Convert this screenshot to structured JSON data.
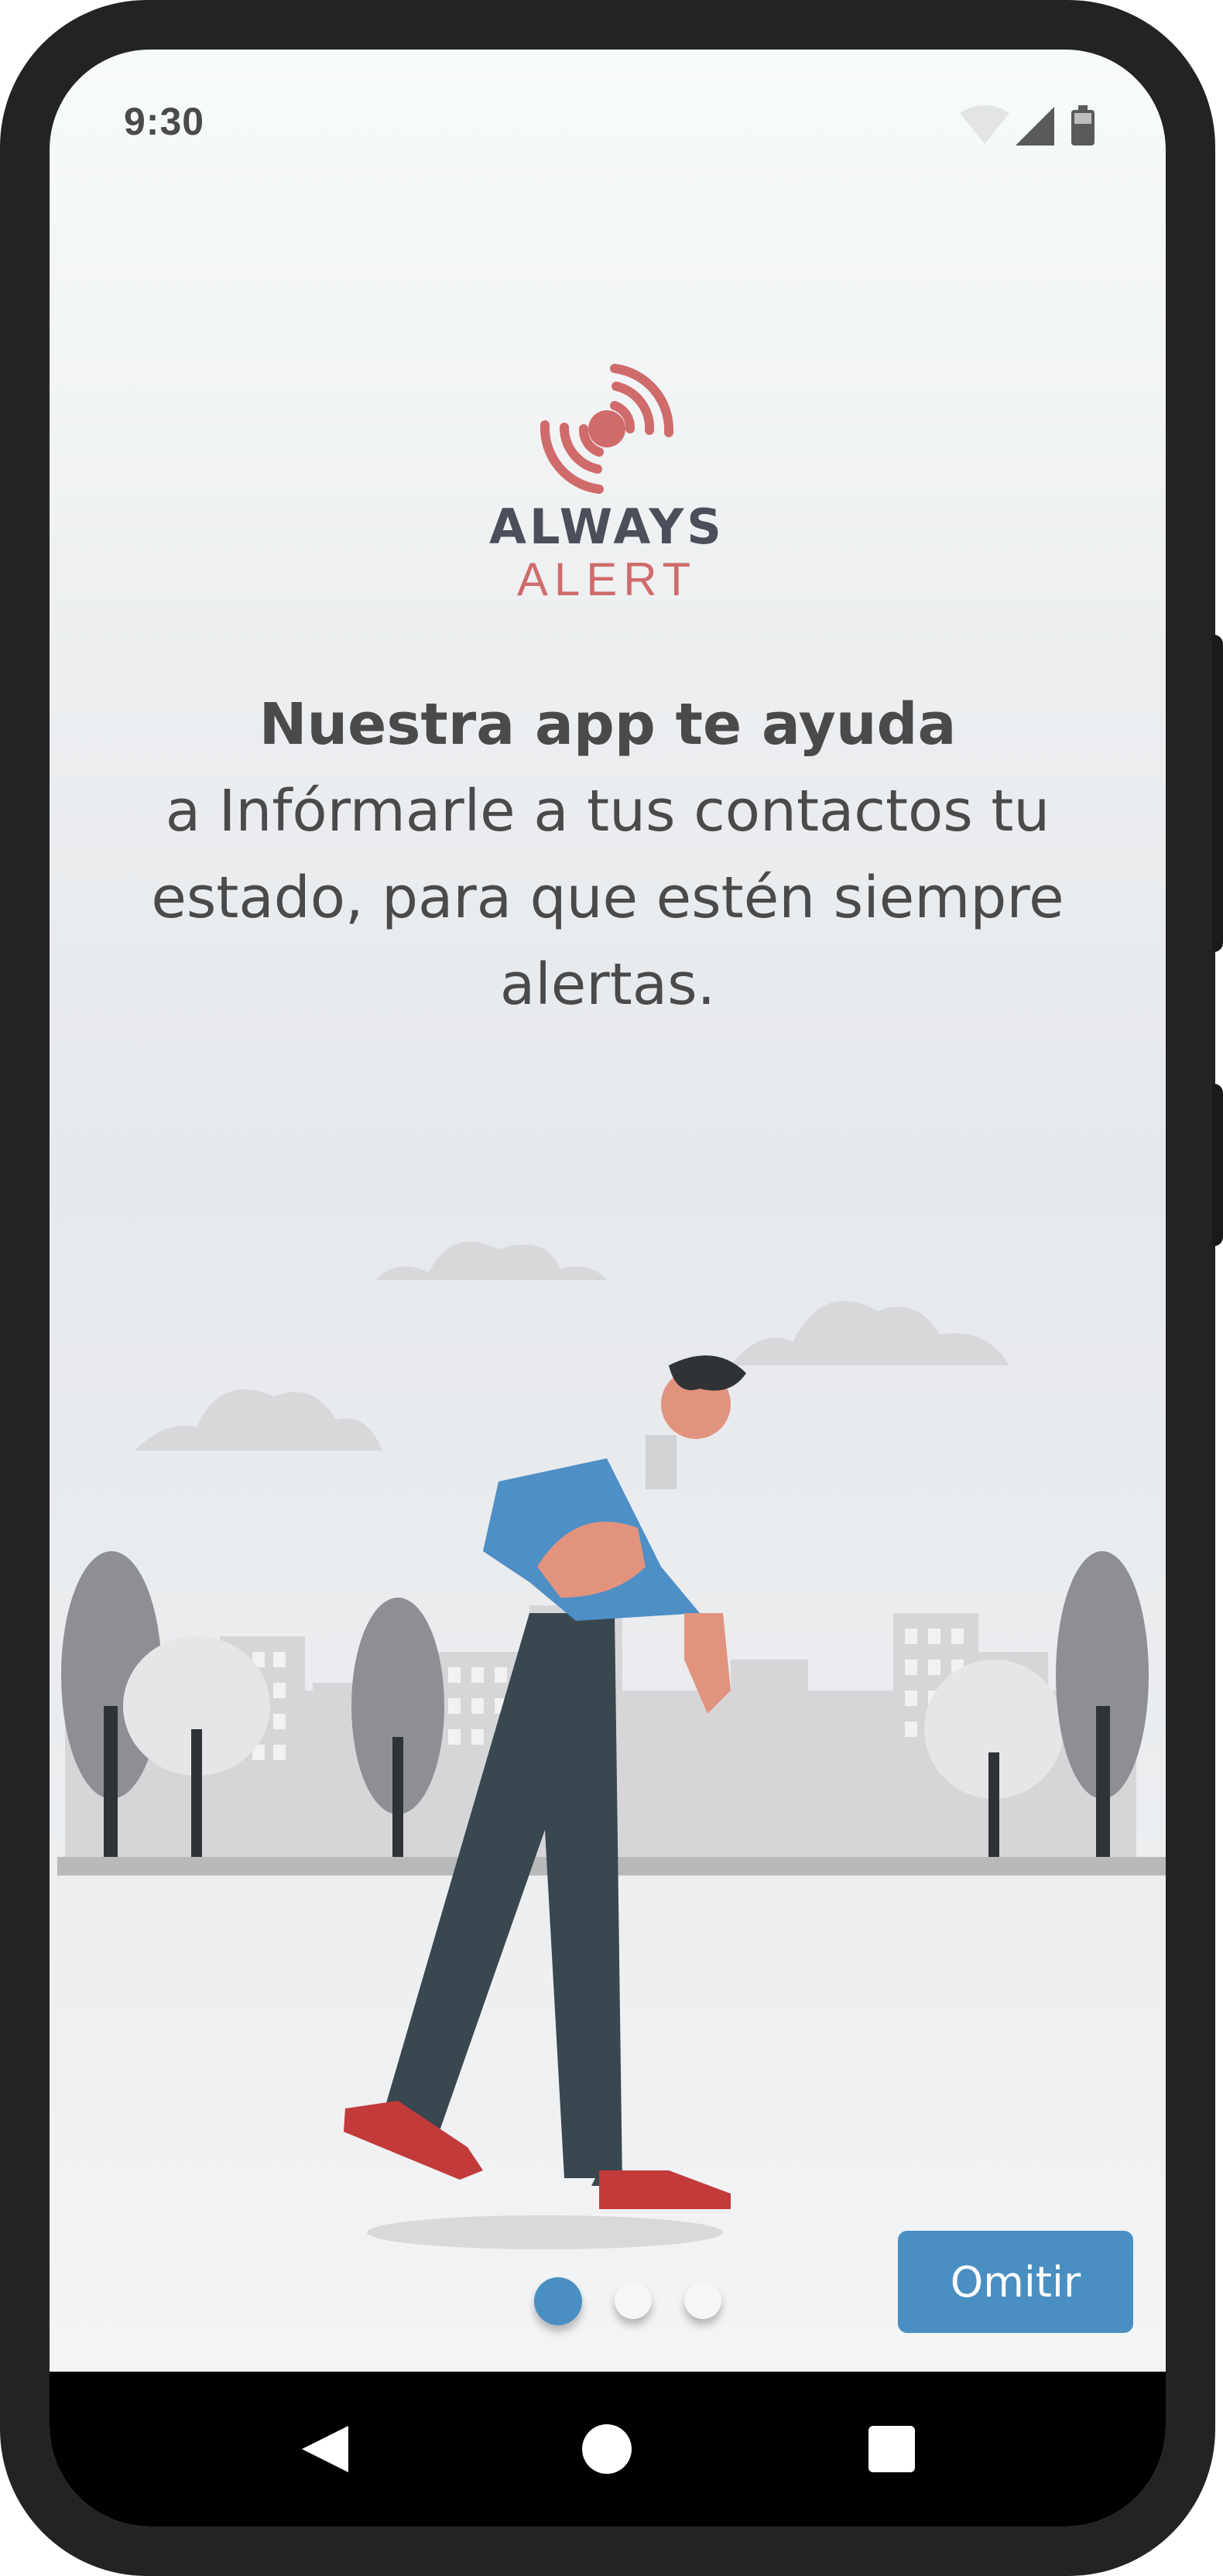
{
  "status_bar": {
    "time": "9:30"
  },
  "logo": {
    "line1": "ALWAYS",
    "line2": "ALERT",
    "accent_color": "#d06b6b",
    "dark_color": "#4a4f5a"
  },
  "onboarding": {
    "headline_bold": "Nuestra app te ayuda",
    "headline_rest": "a Infórmarle a tus contactos tu estado, para que estén siempre alertas."
  },
  "pager": {
    "total_pages": 3,
    "current_page": 1,
    "active_color": "#4a8fc1"
  },
  "actions": {
    "skip_label": "Omitir"
  },
  "nav_bar": {
    "icons": [
      "back-icon",
      "home-icon",
      "recents-icon"
    ]
  }
}
